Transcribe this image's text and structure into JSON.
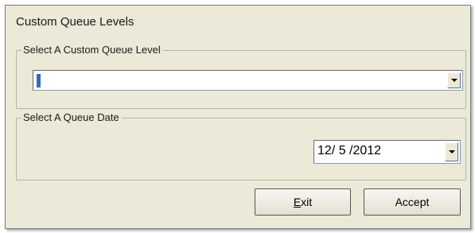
{
  "window": {
    "title": "Custom Queue Levels"
  },
  "queue_level": {
    "legend": "Select A Custom Queue Level",
    "value": ""
  },
  "queue_date": {
    "legend": "Select A Queue Date",
    "value": "12/ 5 /2012"
  },
  "buttons": {
    "exit_mnemonic": "E",
    "exit_rest": "xit",
    "accept_label": "Accept"
  },
  "colors": {
    "dialog_bg": "#ece9d8",
    "caret": "#316ac5"
  },
  "icons": {
    "dropdown": "chevron-down-icon"
  }
}
